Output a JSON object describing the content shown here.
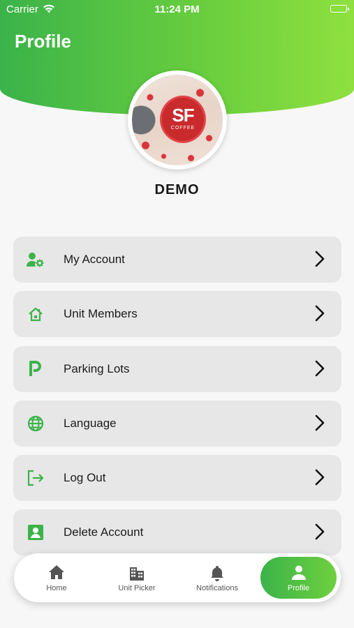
{
  "status_bar": {
    "carrier": "Carrier",
    "time": "11:24 PM"
  },
  "header": {
    "title": "Profile"
  },
  "avatar": {
    "logo_text": "SF",
    "logo_sub": "COFFEE"
  },
  "user": {
    "name": "DEMO"
  },
  "menu": {
    "items": [
      {
        "label": "My Account",
        "icon": "user-gear-icon"
      },
      {
        "label": "Unit Members",
        "icon": "home-icon"
      },
      {
        "label": "Parking Lots",
        "icon": "parking-icon"
      },
      {
        "label": "Language",
        "icon": "globe-icon"
      },
      {
        "label": "Log Out",
        "icon": "logout-icon"
      },
      {
        "label": "Delete Account",
        "icon": "account-box-icon"
      }
    ]
  },
  "bottom_nav": {
    "items": [
      {
        "label": "Home",
        "icon": "home-icon"
      },
      {
        "label": "Unit Picker",
        "icon": "building-icon"
      },
      {
        "label": "Notifications",
        "icon": "bell-icon"
      },
      {
        "label": "Profile",
        "icon": "person-icon",
        "active": true
      }
    ]
  },
  "colors": {
    "accent": "#3bb34a",
    "accent_light": "#8fe03f",
    "menu_bg": "#e7e7e7"
  }
}
